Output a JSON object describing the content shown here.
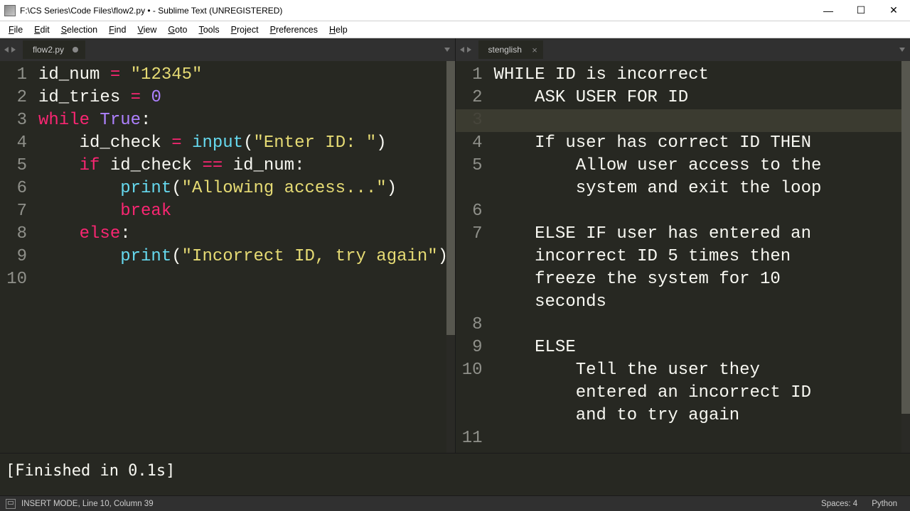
{
  "window": {
    "title": "F:\\CS Series\\Code Files\\flow2.py • - Sublime Text (UNREGISTERED)"
  },
  "menu": [
    "File",
    "Edit",
    "Selection",
    "Find",
    "View",
    "Goto",
    "Tools",
    "Project",
    "Preferences",
    "Help"
  ],
  "tabs": {
    "left": {
      "name": "flow2.py",
      "dirty": true
    },
    "right": {
      "name": "stenglish",
      "dirty": false
    }
  },
  "left_pane": {
    "lines": [
      {
        "n": 1,
        "tokens": [
          [
            "p",
            "id_num "
          ],
          [
            "op",
            "="
          ],
          [
            "p",
            " "
          ],
          [
            "str",
            "\"12345\""
          ]
        ]
      },
      {
        "n": 2,
        "tokens": [
          [
            "p",
            "id_tries "
          ],
          [
            "op",
            "="
          ],
          [
            "p",
            " "
          ],
          [
            "num",
            "0"
          ]
        ]
      },
      {
        "n": 3,
        "tokens": [
          [
            "p",
            ""
          ]
        ]
      },
      {
        "n": 4,
        "tokens": [
          [
            "kw",
            "while"
          ],
          [
            "p",
            " "
          ],
          [
            "num",
            "True"
          ],
          [
            "p",
            ":"
          ]
        ]
      },
      {
        "n": 5,
        "tokens": [
          [
            "p",
            "    id_check "
          ],
          [
            "op",
            "="
          ],
          [
            "p",
            " "
          ],
          [
            "fn",
            "input"
          ],
          [
            "p",
            "("
          ],
          [
            "str",
            "\"Enter ID: \""
          ],
          [
            "p",
            ")"
          ]
        ]
      },
      {
        "n": 6,
        "tokens": [
          [
            "p",
            "    "
          ],
          [
            "kw",
            "if"
          ],
          [
            "p",
            " id_check "
          ],
          [
            "op",
            "=="
          ],
          [
            "p",
            " id_num:"
          ]
        ]
      },
      {
        "n": 7,
        "tokens": [
          [
            "p",
            "        "
          ],
          [
            "fn",
            "print"
          ],
          [
            "p",
            "("
          ],
          [
            "str",
            "\"Allowing access...\""
          ],
          [
            "p",
            ")"
          ]
        ]
      },
      {
        "n": 8,
        "tokens": [
          [
            "p",
            "        "
          ],
          [
            "kw",
            "break"
          ]
        ]
      },
      {
        "n": 9,
        "tokens": [
          [
            "p",
            "    "
          ],
          [
            "kw",
            "else"
          ],
          [
            "p",
            ":"
          ]
        ]
      },
      {
        "n": 10,
        "tokens": [
          [
            "p",
            "        "
          ],
          [
            "fn",
            "print"
          ],
          [
            "p",
            "("
          ],
          [
            "str",
            "\"Incorrect ID, try again\""
          ],
          [
            "p",
            ")"
          ]
        ]
      }
    ]
  },
  "right_pane": {
    "lines": [
      {
        "n": 1,
        "text": "WHILE ID is incorrect"
      },
      {
        "n": 2,
        "text": "    ASK USER FOR ID"
      },
      {
        "n": 3,
        "text": "",
        "hl": true
      },
      {
        "n": 4,
        "text": "    If user has correct ID THEN"
      },
      {
        "n": 5,
        "text": "        Allow user access to the"
      },
      {
        "n": "",
        "text": "        system and exit the loop"
      },
      {
        "n": 6,
        "text": ""
      },
      {
        "n": 7,
        "text": "    ELSE IF user has entered an"
      },
      {
        "n": "",
        "text": "    incorrect ID 5 times then"
      },
      {
        "n": "",
        "text": "    freeze the system for 10"
      },
      {
        "n": "",
        "text": "    seconds"
      },
      {
        "n": 8,
        "text": ""
      },
      {
        "n": 9,
        "text": "    ELSE"
      },
      {
        "n": 10,
        "text": "        Tell the user they"
      },
      {
        "n": "",
        "text": "        entered an incorrect ID"
      },
      {
        "n": "",
        "text": "        and to try again"
      },
      {
        "n": 11,
        "text": ""
      }
    ]
  },
  "output": "[Finished in 0.1s]",
  "status": {
    "mode": "INSERT MODE,",
    "pos": "Line 10, Column 39",
    "spaces": "Spaces: 4",
    "lang": "Python"
  }
}
